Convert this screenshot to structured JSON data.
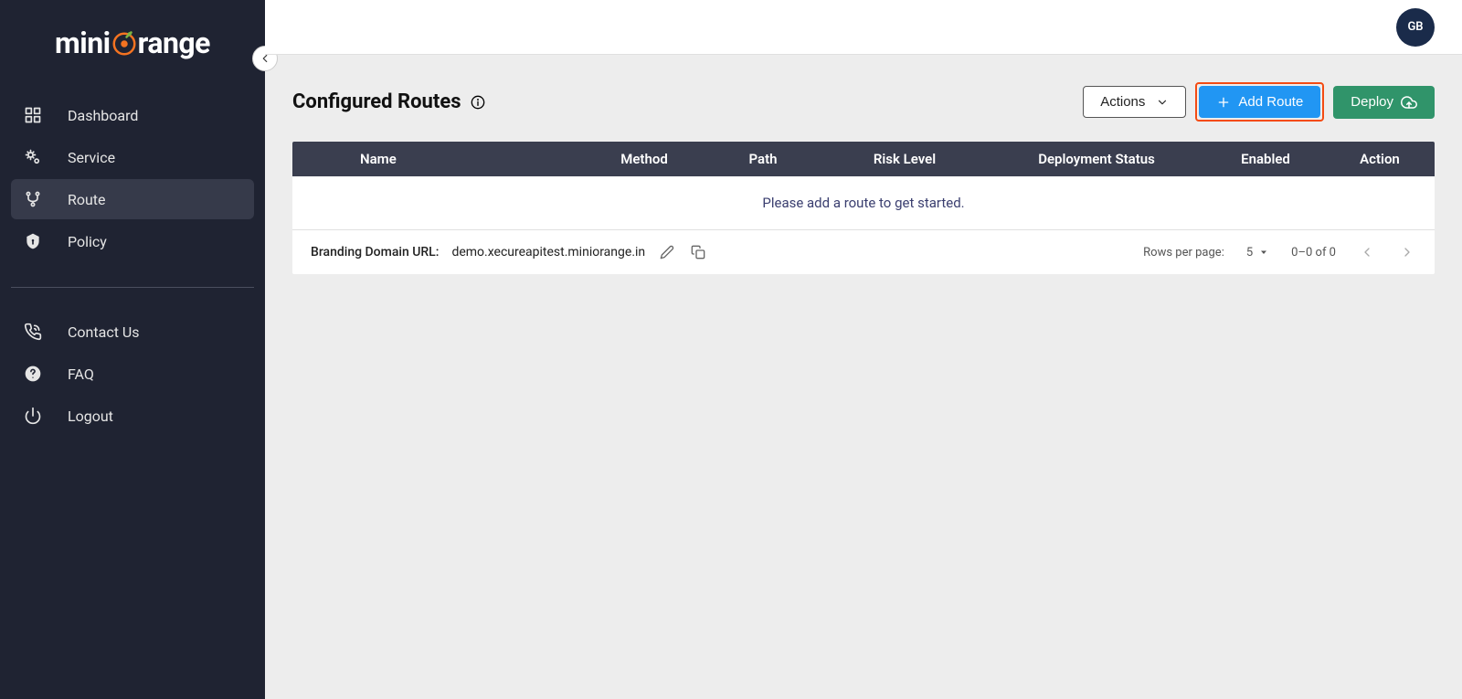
{
  "brand": {
    "name_prefix": "mini",
    "name_accent": "o",
    "name_suffix": "range"
  },
  "avatar_initials": "GB",
  "sidebar": {
    "items": [
      {
        "label": "Dashboard"
      },
      {
        "label": "Service"
      },
      {
        "label": "Route"
      },
      {
        "label": "Policy"
      }
    ],
    "secondary": [
      {
        "label": "Contact Us"
      },
      {
        "label": "FAQ"
      },
      {
        "label": "Logout"
      }
    ]
  },
  "page": {
    "title": "Configured Routes"
  },
  "actions": {
    "dropdown_label": "Actions",
    "add_route_label": "Add Route",
    "deploy_label": "Deploy"
  },
  "table": {
    "columns": {
      "name": "Name",
      "method": "Method",
      "path": "Path",
      "risk": "Risk Level",
      "deploy": "Deployment Status",
      "enabled": "Enabled",
      "action": "Action"
    },
    "empty_message": "Please add a route to get started."
  },
  "footer": {
    "branding_label": "Branding Domain URL:",
    "branding_value": "demo.xecureapitest.miniorange.in",
    "rows_per_page_label": "Rows per page:",
    "rows_per_page_value": "5",
    "range_text": "0–0 of 0"
  }
}
